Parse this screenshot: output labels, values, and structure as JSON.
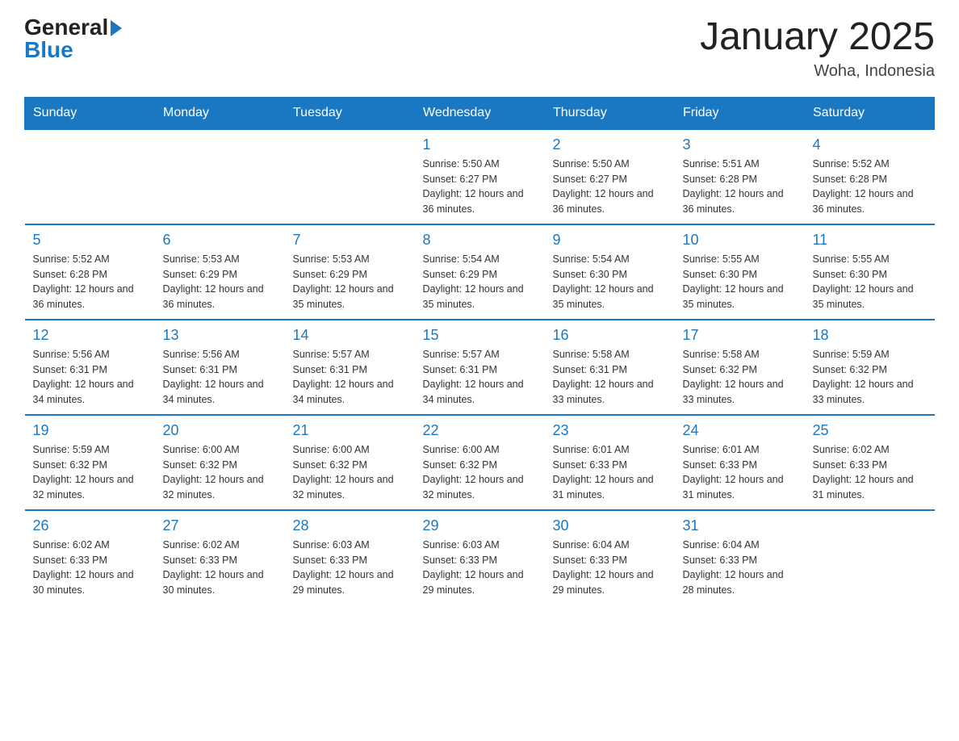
{
  "header": {
    "logo_general": "General",
    "logo_blue": "Blue",
    "month_title": "January 2025",
    "location": "Woha, Indonesia"
  },
  "weekdays": [
    "Sunday",
    "Monday",
    "Tuesday",
    "Wednesday",
    "Thursday",
    "Friday",
    "Saturday"
  ],
  "weeks": [
    [
      {
        "day": "",
        "info": ""
      },
      {
        "day": "",
        "info": ""
      },
      {
        "day": "",
        "info": ""
      },
      {
        "day": "1",
        "info": "Sunrise: 5:50 AM\nSunset: 6:27 PM\nDaylight: 12 hours\nand 36 minutes."
      },
      {
        "day": "2",
        "info": "Sunrise: 5:50 AM\nSunset: 6:27 PM\nDaylight: 12 hours\nand 36 minutes."
      },
      {
        "day": "3",
        "info": "Sunrise: 5:51 AM\nSunset: 6:28 PM\nDaylight: 12 hours\nand 36 minutes."
      },
      {
        "day": "4",
        "info": "Sunrise: 5:52 AM\nSunset: 6:28 PM\nDaylight: 12 hours\nand 36 minutes."
      }
    ],
    [
      {
        "day": "5",
        "info": "Sunrise: 5:52 AM\nSunset: 6:28 PM\nDaylight: 12 hours\nand 36 minutes."
      },
      {
        "day": "6",
        "info": "Sunrise: 5:53 AM\nSunset: 6:29 PM\nDaylight: 12 hours\nand 36 minutes."
      },
      {
        "day": "7",
        "info": "Sunrise: 5:53 AM\nSunset: 6:29 PM\nDaylight: 12 hours\nand 35 minutes."
      },
      {
        "day": "8",
        "info": "Sunrise: 5:54 AM\nSunset: 6:29 PM\nDaylight: 12 hours\nand 35 minutes."
      },
      {
        "day": "9",
        "info": "Sunrise: 5:54 AM\nSunset: 6:30 PM\nDaylight: 12 hours\nand 35 minutes."
      },
      {
        "day": "10",
        "info": "Sunrise: 5:55 AM\nSunset: 6:30 PM\nDaylight: 12 hours\nand 35 minutes."
      },
      {
        "day": "11",
        "info": "Sunrise: 5:55 AM\nSunset: 6:30 PM\nDaylight: 12 hours\nand 35 minutes."
      }
    ],
    [
      {
        "day": "12",
        "info": "Sunrise: 5:56 AM\nSunset: 6:31 PM\nDaylight: 12 hours\nand 34 minutes."
      },
      {
        "day": "13",
        "info": "Sunrise: 5:56 AM\nSunset: 6:31 PM\nDaylight: 12 hours\nand 34 minutes."
      },
      {
        "day": "14",
        "info": "Sunrise: 5:57 AM\nSunset: 6:31 PM\nDaylight: 12 hours\nand 34 minutes."
      },
      {
        "day": "15",
        "info": "Sunrise: 5:57 AM\nSunset: 6:31 PM\nDaylight: 12 hours\nand 34 minutes."
      },
      {
        "day": "16",
        "info": "Sunrise: 5:58 AM\nSunset: 6:31 PM\nDaylight: 12 hours\nand 33 minutes."
      },
      {
        "day": "17",
        "info": "Sunrise: 5:58 AM\nSunset: 6:32 PM\nDaylight: 12 hours\nand 33 minutes."
      },
      {
        "day": "18",
        "info": "Sunrise: 5:59 AM\nSunset: 6:32 PM\nDaylight: 12 hours\nand 33 minutes."
      }
    ],
    [
      {
        "day": "19",
        "info": "Sunrise: 5:59 AM\nSunset: 6:32 PM\nDaylight: 12 hours\nand 32 minutes."
      },
      {
        "day": "20",
        "info": "Sunrise: 6:00 AM\nSunset: 6:32 PM\nDaylight: 12 hours\nand 32 minutes."
      },
      {
        "day": "21",
        "info": "Sunrise: 6:00 AM\nSunset: 6:32 PM\nDaylight: 12 hours\nand 32 minutes."
      },
      {
        "day": "22",
        "info": "Sunrise: 6:00 AM\nSunset: 6:32 PM\nDaylight: 12 hours\nand 32 minutes."
      },
      {
        "day": "23",
        "info": "Sunrise: 6:01 AM\nSunset: 6:33 PM\nDaylight: 12 hours\nand 31 minutes."
      },
      {
        "day": "24",
        "info": "Sunrise: 6:01 AM\nSunset: 6:33 PM\nDaylight: 12 hours\nand 31 minutes."
      },
      {
        "day": "25",
        "info": "Sunrise: 6:02 AM\nSunset: 6:33 PM\nDaylight: 12 hours\nand 31 minutes."
      }
    ],
    [
      {
        "day": "26",
        "info": "Sunrise: 6:02 AM\nSunset: 6:33 PM\nDaylight: 12 hours\nand 30 minutes."
      },
      {
        "day": "27",
        "info": "Sunrise: 6:02 AM\nSunset: 6:33 PM\nDaylight: 12 hours\nand 30 minutes."
      },
      {
        "day": "28",
        "info": "Sunrise: 6:03 AM\nSunset: 6:33 PM\nDaylight: 12 hours\nand 29 minutes."
      },
      {
        "day": "29",
        "info": "Sunrise: 6:03 AM\nSunset: 6:33 PM\nDaylight: 12 hours\nand 29 minutes."
      },
      {
        "day": "30",
        "info": "Sunrise: 6:04 AM\nSunset: 6:33 PM\nDaylight: 12 hours\nand 29 minutes."
      },
      {
        "day": "31",
        "info": "Sunrise: 6:04 AM\nSunset: 6:33 PM\nDaylight: 12 hours\nand 28 minutes."
      },
      {
        "day": "",
        "info": ""
      }
    ]
  ]
}
